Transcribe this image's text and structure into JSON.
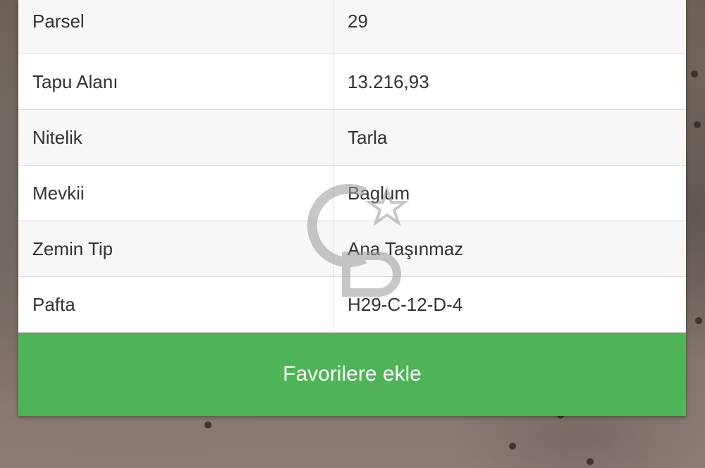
{
  "table": {
    "rows": [
      {
        "label": "Parsel",
        "value": "29"
      },
      {
        "label": "Tapu Alanı",
        "value": "13.216,93"
      },
      {
        "label": "Nitelik",
        "value": "Tarla"
      },
      {
        "label": "Mevkii",
        "value": "Baglum"
      },
      {
        "label": "Zemin Tip",
        "value": "Ana Taşınmaz"
      },
      {
        "label": "Pafta",
        "value": "H29-C-12-D-4"
      }
    ]
  },
  "actions": {
    "favorite_label": "Favorilere ekle"
  },
  "colors": {
    "button_green": "#4fb357",
    "row_alt": "#f7f7f7",
    "text": "#333333"
  }
}
